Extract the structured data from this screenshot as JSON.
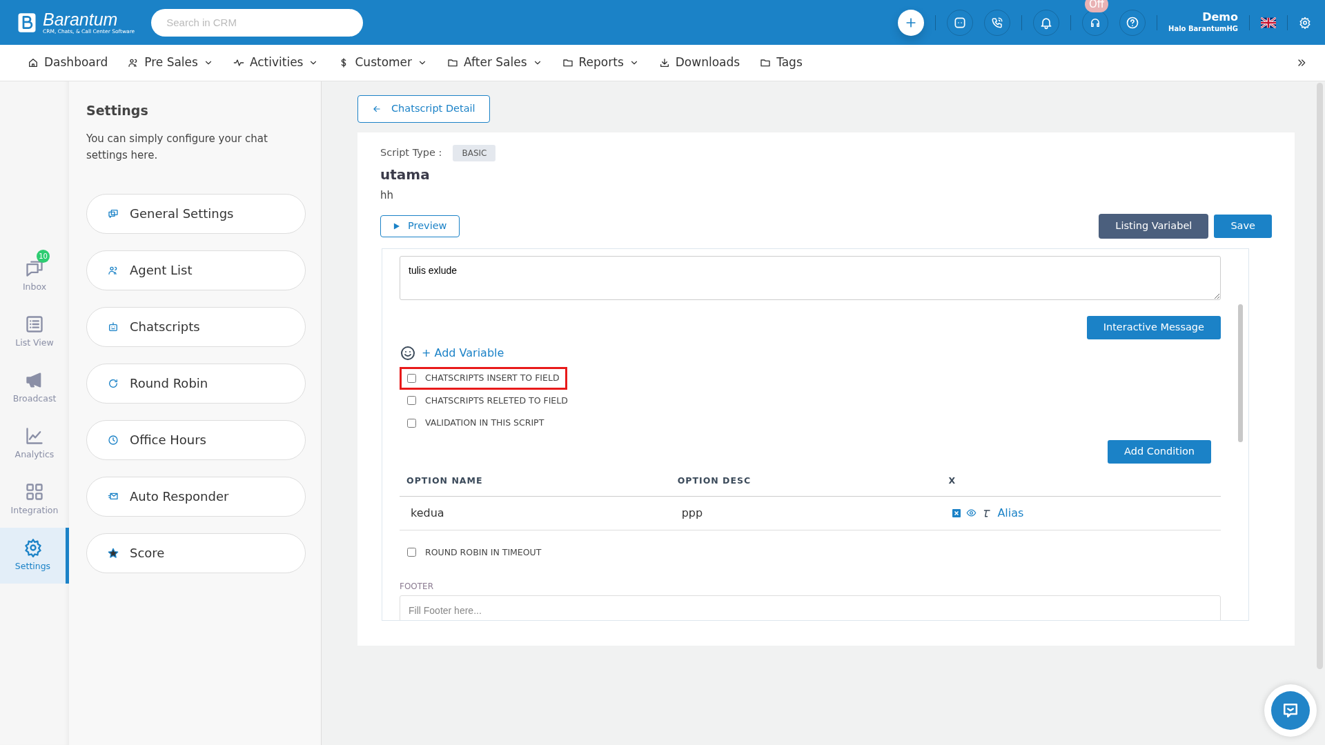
{
  "header": {
    "logo": {
      "name": "Barantum",
      "tagline": "CRM, Chats, & Call Center Software"
    },
    "search": {
      "placeholder": "Search in CRM"
    },
    "status_badge": "Off",
    "user": {
      "name": "Demo",
      "company": "Halo BarantumHG"
    }
  },
  "nav": [
    {
      "label": "Dashboard",
      "dropdown": false
    },
    {
      "label": "Pre Sales",
      "dropdown": true
    },
    {
      "label": "Activities",
      "dropdown": true
    },
    {
      "label": "Customer",
      "dropdown": true
    },
    {
      "label": "After Sales",
      "dropdown": true
    },
    {
      "label": "Reports",
      "dropdown": true
    },
    {
      "label": "Downloads",
      "dropdown": false
    },
    {
      "label": "Tags",
      "dropdown": false
    }
  ],
  "rail": [
    {
      "label": "Inbox",
      "badge": "10",
      "selected": false
    },
    {
      "label": "List View",
      "selected": false
    },
    {
      "label": "Broadcast",
      "selected": false
    },
    {
      "label": "Analytics",
      "selected": false
    },
    {
      "label": "Integration",
      "selected": false
    },
    {
      "label": "Settings",
      "selected": true
    }
  ],
  "settings": {
    "title": "Settings",
    "description": "You can simply configure your chat settings here.",
    "items": [
      "General Settings",
      "Agent List",
      "Chatscripts",
      "Round Robin",
      "Office Hours",
      "Auto Responder",
      "Score"
    ]
  },
  "back_button": "Chatscript Detail",
  "script": {
    "type_label": "Script Type :",
    "type": "BASIC",
    "name": "utama",
    "description": "hh"
  },
  "buttons": {
    "preview": "Preview",
    "listing": "Listing Variabel",
    "save": "Save",
    "interactive": "Interactive Message",
    "add_variable": "+ Add Variable",
    "add_condition": "Add Condition"
  },
  "content": "tulis exlude",
  "checkboxes": [
    {
      "label": "CHATSCRIPTS INSERT TO FIELD",
      "checked": false,
      "highlighted": true
    },
    {
      "label": "CHATSCRIPTS RELETED TO FIELD",
      "checked": false,
      "highlighted": false
    },
    {
      "label": "VALIDATION IN THIS SCRIPT",
      "checked": false,
      "highlighted": false
    }
  ],
  "table": {
    "columns": [
      "OPTION NAME",
      "OPTION DESC",
      "X"
    ],
    "rows": [
      {
        "name": "kedua",
        "desc": "ppp",
        "action": "Alias"
      }
    ]
  },
  "timeout_checkbox": {
    "label": "ROUND ROBIN IN TIMEOUT",
    "checked": false
  },
  "footer": {
    "label": "FOOTER",
    "placeholder": "Fill Footer here..."
  }
}
